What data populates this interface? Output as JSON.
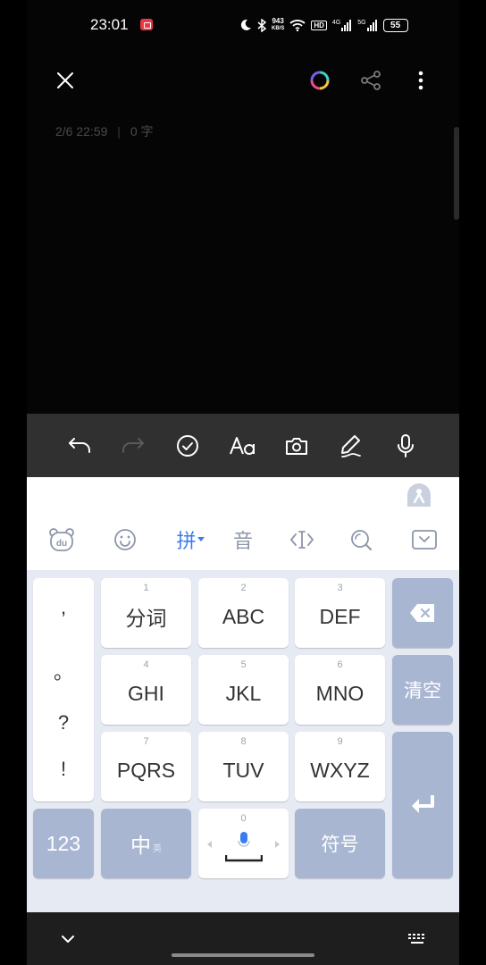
{
  "status_bar": {
    "time": "23:01",
    "net_speed_value": "943",
    "net_speed_unit": "KB/S",
    "hd": "HD",
    "sim1": "4G",
    "sim2": "5G",
    "battery": "55"
  },
  "note": {
    "meta_date": "2/6 22:59",
    "meta_count": "0 字"
  },
  "icons": [
    "close-icon",
    "color-ring-icon",
    "share-icon",
    "more-icon",
    "undo-icon",
    "redo-icon",
    "check-circle-icon",
    "text-format-icon",
    "camera-icon",
    "pen-icon",
    "mic-icon"
  ],
  "keyboard": {
    "tabs": {
      "du_logo": "du",
      "pinyin": "拼",
      "yin": "音"
    },
    "punct": [
      ",",
      "。",
      "?",
      "!"
    ],
    "keys": {
      "k1": {
        "num": "1",
        "label": "分词"
      },
      "k2": {
        "num": "2",
        "label": "ABC"
      },
      "k3": {
        "num": "3",
        "label": "DEF"
      },
      "k4": {
        "num": "4",
        "label": "GHI"
      },
      "k5": {
        "num": "5",
        "label": "JKL"
      },
      "k6": {
        "num": "6",
        "label": "MNO"
      },
      "k7": {
        "num": "7",
        "label": "PQRS"
      },
      "k8": {
        "num": "8",
        "label": "TUV"
      },
      "k9": {
        "num": "9",
        "label": "WXYZ"
      },
      "k0": {
        "num": "0"
      }
    },
    "clear": "清空",
    "num_mode": "123",
    "lang": "中",
    "lang_sub": "英",
    "symbols": "符号"
  },
  "colors": {
    "accent": "#3b7df0",
    "key_dark": "#a9b6d2",
    "keyboard_bg": "#e6eaf3"
  }
}
